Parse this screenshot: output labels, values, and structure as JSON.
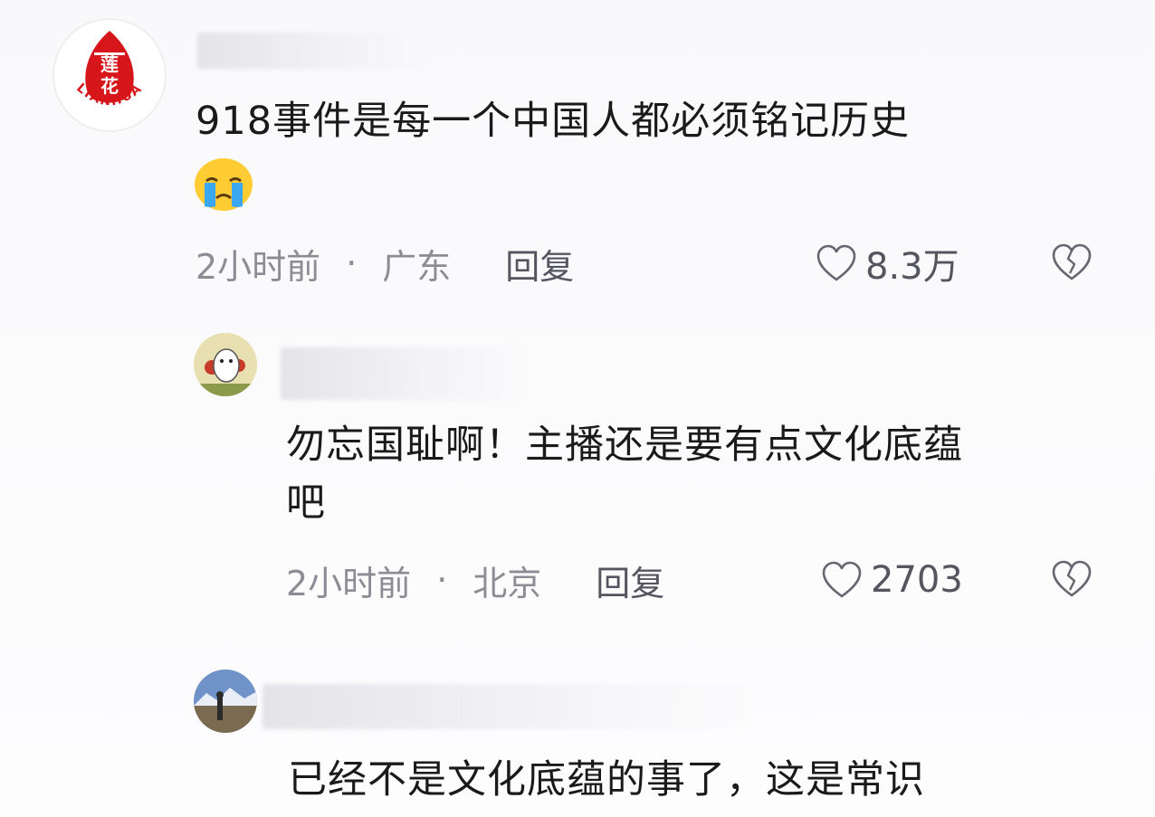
{
  "comments": [
    {
      "text": "918事件是每一个中国人都必须铭记历史",
      "emoji": "😭",
      "time": "2小时前",
      "separator": "·",
      "location": "广东",
      "reply_label": "回复",
      "likes": "8.3万",
      "avatar_logo_text": "LIANHUA",
      "avatar_logo_chars": "莲花"
    },
    {
      "text_line1": "勿忘国耻啊！主播还是要有点文化底蕴",
      "text_line2": "吧",
      "time": "2小时前",
      "separator": "·",
      "location": "北京",
      "reply_label": "回复",
      "likes": "2703"
    },
    {
      "text": "已经不是文化底蕴的事了，这是常识"
    }
  ],
  "icons": {
    "like": "heart-outline-icon",
    "dislike": "broken-heart-icon"
  },
  "colors": {
    "logo_red": "#d7161c",
    "meta_gray": "#8c8c94",
    "text": "#1a1a1a"
  }
}
